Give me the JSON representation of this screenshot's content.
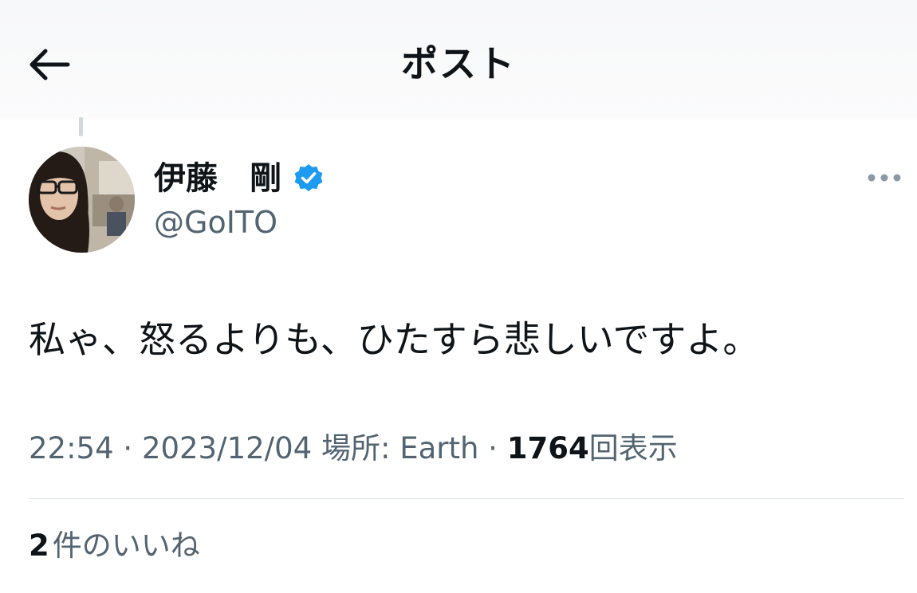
{
  "header": {
    "title": "ポスト",
    "back_icon": "arrow-left-icon"
  },
  "post": {
    "author": {
      "display_name": "伊藤　剛",
      "handle": "@GoITO",
      "verified": true,
      "verified_color": "#1d9bf0"
    },
    "more_icon": "more-horizontal-icon",
    "text": "私ゃ、怒るよりも、ひたすら悲しいですよ。",
    "meta": {
      "time": "22:54",
      "sep1": " · ",
      "date": "2023/12/04",
      "location": " 場所: Earth",
      "sep2": " · ",
      "views_count": "1764",
      "views_label": "回表示"
    },
    "likes": {
      "count": "2",
      "label": "件のいいね"
    }
  },
  "colors": {
    "text_primary": "#0f1419",
    "text_secondary": "#536471",
    "accent": "#1d9bf0",
    "divider": "#e1e6ea"
  }
}
